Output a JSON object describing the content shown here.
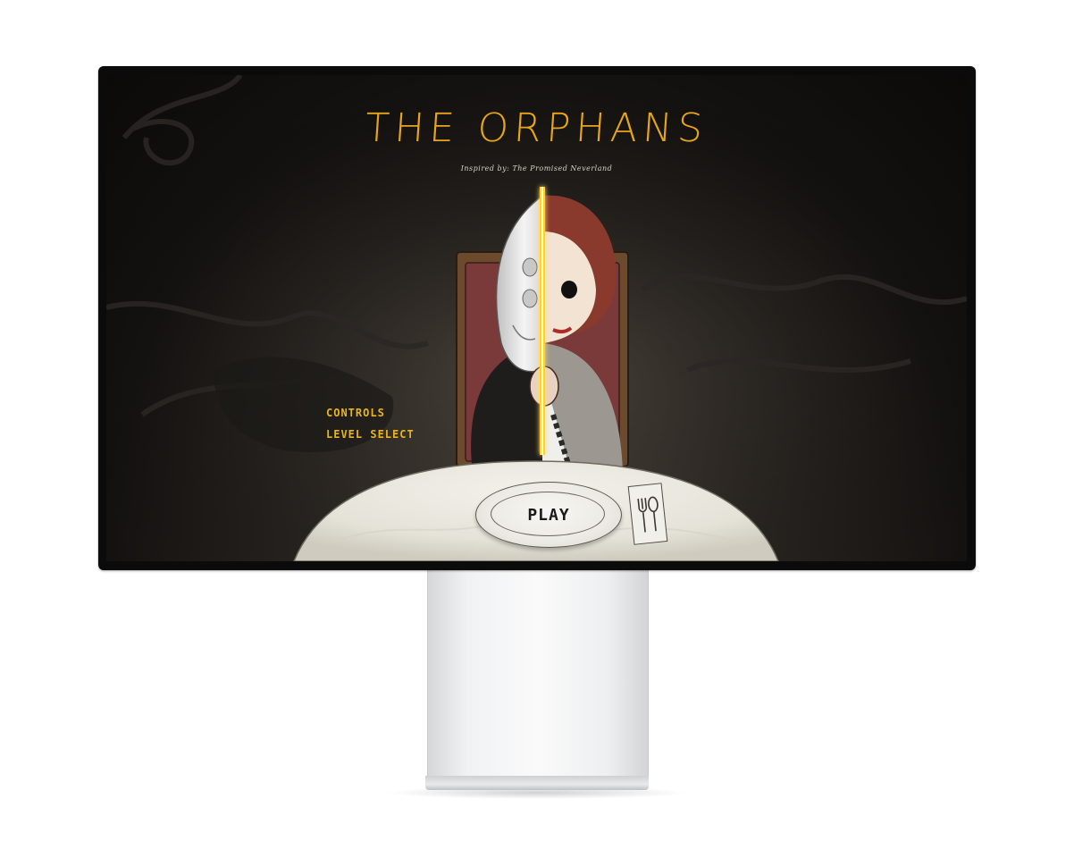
{
  "game": {
    "title": "THE ORPHANS",
    "subtitle": "Inspired by: The Promised Neverland"
  },
  "menu": {
    "controls_label": "CONTROLS",
    "level_select_label": "LEVEL SELECT",
    "play_label": "PLAY"
  },
  "colors": {
    "title_gold": "#e6a51a",
    "menu_gold": "#e8b51e",
    "sword_glow": "#ffd21a",
    "bezel": "#0b0b0b",
    "table": "#ebe8df"
  },
  "icons": {
    "cutlery": "fork-spoon-icon",
    "sword": "glowing-sword-icon"
  }
}
